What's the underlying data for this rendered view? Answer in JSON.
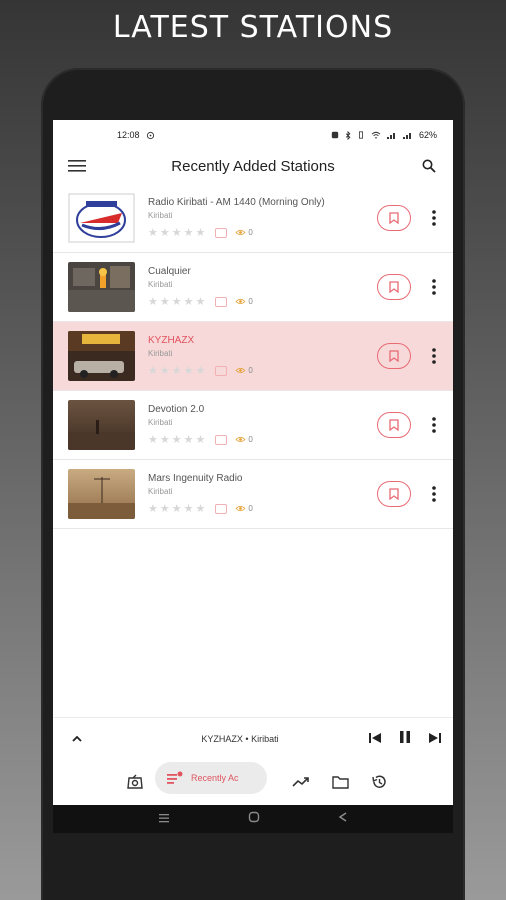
{
  "headline": "LATEST STATIONS",
  "status": {
    "time": "12:08",
    "battery": "62%"
  },
  "header": {
    "title": "Recently Added Stations"
  },
  "stations": [
    {
      "name": "Radio Kiribati - AM 1440 (Morning Only)",
      "country": "Kiribati",
      "views": "0",
      "active": false
    },
    {
      "name": "Cualquier",
      "country": "Kiribati",
      "views": "0",
      "active": false
    },
    {
      "name": "KYZHAZX",
      "country": "Kiribati",
      "views": "0",
      "active": true
    },
    {
      "name": "Devotion 2.0",
      "country": "Kiribati",
      "views": "0",
      "active": false
    },
    {
      "name": "Mars Ingenuity Radio",
      "country": "Kiribati",
      "views": "0",
      "active": false
    }
  ],
  "rating": {
    "stars_filled": 0,
    "stars_total": 5
  },
  "player": {
    "now_playing": "KYZHAZX • Kiribati"
  },
  "nav": {
    "active_label": "Recently Ac"
  },
  "colors": {
    "accent": "#e05560",
    "active_row": "#f8d9da"
  }
}
